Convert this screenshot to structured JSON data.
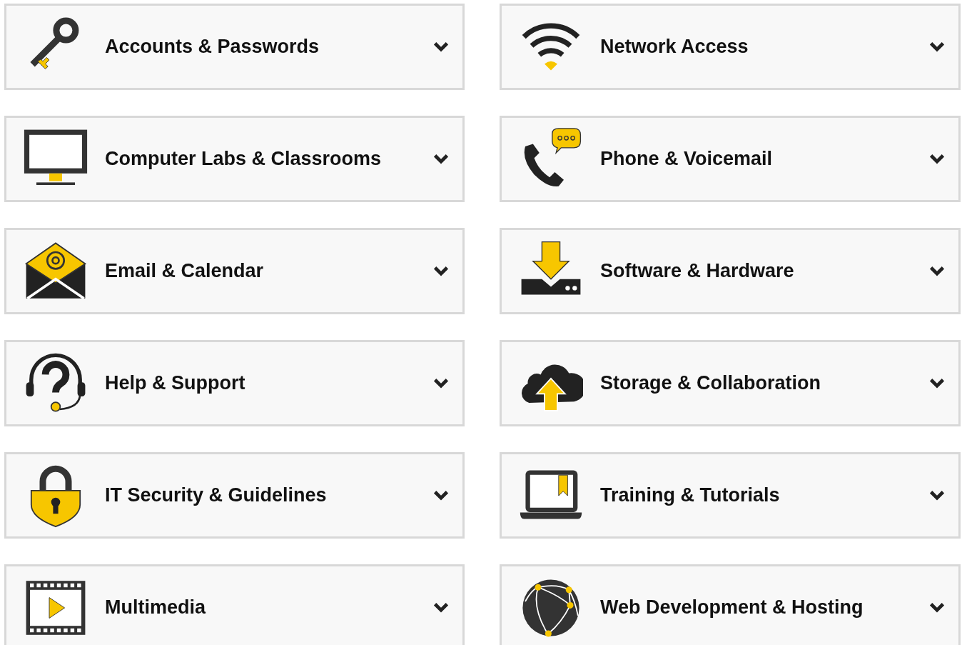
{
  "categories": [
    {
      "title": "Accounts & Passwords",
      "expanded": false
    },
    {
      "title": "Network Access",
      "expanded": false
    },
    {
      "title": "Computer Labs & Classrooms",
      "expanded": false
    },
    {
      "title": "Phone & Voicemail",
      "expanded": false
    },
    {
      "title": "Email & Calendar",
      "expanded": false
    },
    {
      "title": "Software & Hardware",
      "expanded": false
    },
    {
      "title": "Help & Support",
      "expanded": false
    },
    {
      "title": "Storage & Collaboration",
      "expanded": false
    },
    {
      "title": "IT Security & Guidelines",
      "expanded": false
    },
    {
      "title": "Training & Tutorials",
      "expanded": false
    },
    {
      "title": "Multimedia",
      "expanded": false
    },
    {
      "title": "Web Development & Hosting",
      "expanded": false
    }
  ]
}
